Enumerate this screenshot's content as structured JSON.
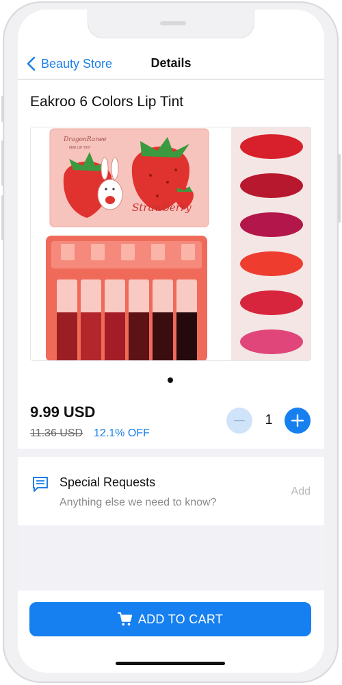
{
  "nav": {
    "back_label": "Beauty Store",
    "title": "Details"
  },
  "product": {
    "title": "Eakroo 6 Colors Lip Tint",
    "image_brand_text": "DragonRanee",
    "image_sub_text": "MINI LIP TINT",
    "image_flavor_text": "Strawberry",
    "price": "9.99 USD",
    "old_price": "11.36 USD",
    "discount": "12.1% OFF",
    "quantity": "1",
    "page_indicator": {
      "count": 1,
      "active": 0
    }
  },
  "requests": {
    "title": "Special Requests",
    "hint": "Anything else we need to know?",
    "add_label": "Add"
  },
  "cart": {
    "button_label": "ADD TO CART"
  },
  "colors": {
    "accent": "#1680f0",
    "accent_light": "#cfe3f9",
    "text_muted": "#8a8a8e",
    "background": "#f2f2f6"
  },
  "icons": {
    "back": "chevron-left-icon",
    "minus": "minus-icon",
    "plus": "plus-icon",
    "requests": "message-icon",
    "cart": "shopping-cart-icon"
  }
}
